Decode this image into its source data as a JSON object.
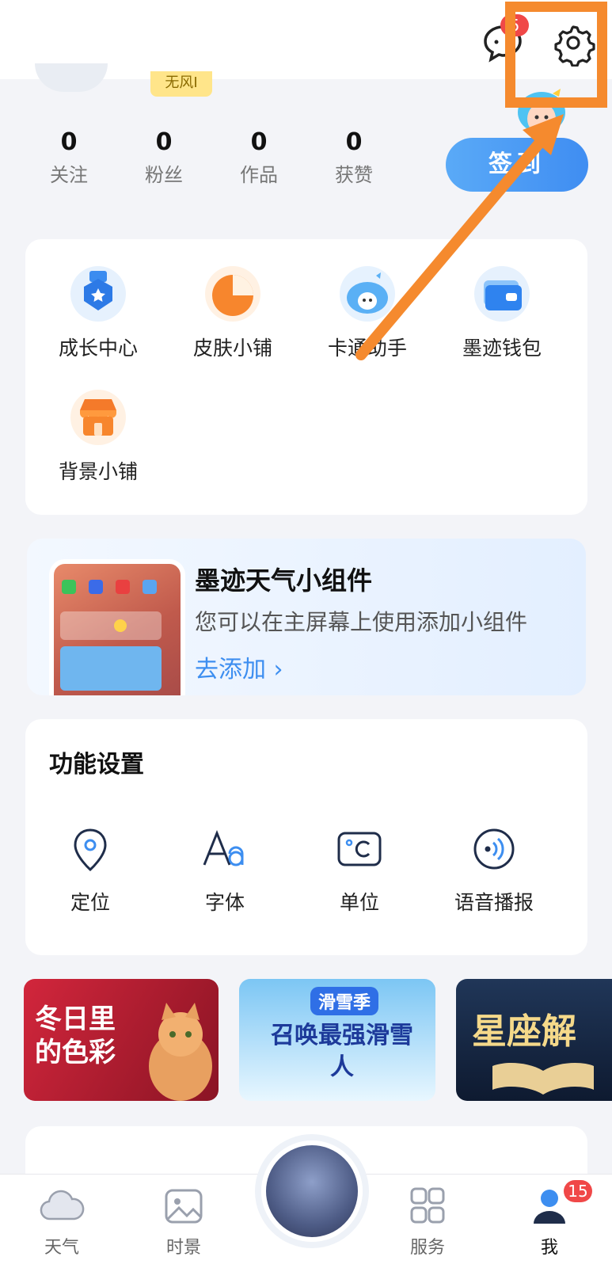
{
  "header": {
    "messages_badge": "5",
    "partial_badge_text": "无风I"
  },
  "stats": [
    {
      "value": "0",
      "label": "关注"
    },
    {
      "value": "0",
      "label": "粉丝"
    },
    {
      "value": "0",
      "label": "作品"
    },
    {
      "value": "0",
      "label": "获赞"
    }
  ],
  "signin_label": "签到",
  "quick_items": [
    {
      "label": "成长中心",
      "icon": "growth-medal-icon"
    },
    {
      "label": "皮肤小铺",
      "icon": "skin-shop-icon"
    },
    {
      "label": "卡通助手",
      "icon": "cartoon-assistant-icon"
    },
    {
      "label": "墨迹钱包",
      "icon": "wallet-icon"
    },
    {
      "label": "背景小铺",
      "icon": "background-shop-icon"
    }
  ],
  "widget": {
    "title": "墨迹天气小组件",
    "desc": "您可以在主屏幕上使用添加小组件",
    "add": "去添加 ›"
  },
  "functions": {
    "title": "功能设置",
    "items": [
      {
        "label": "定位",
        "icon": "location-pin-icon"
      },
      {
        "label": "字体",
        "icon": "font-icon"
      },
      {
        "label": "单位",
        "icon": "celsius-icon"
      },
      {
        "label": "语音播报",
        "icon": "voice-broadcast-icon"
      }
    ]
  },
  "banners": [
    {
      "text": "冬日里的色彩",
      "colors": [
        "#c8243a",
        "#7a1020"
      ]
    },
    {
      "text": "召唤最强滑雪人",
      "tag": "滑雪季",
      "colors": [
        "#6ab8f2",
        "#dff3ff"
      ]
    },
    {
      "text": "星座解",
      "colors": [
        "#1b2c4a",
        "#0d1729"
      ]
    }
  ],
  "tabs": [
    {
      "label": "天气",
      "icon": "cloud-icon"
    },
    {
      "label": "时景",
      "icon": "photo-icon"
    },
    {
      "label": "服务",
      "icon": "grid-icon"
    },
    {
      "label": "我",
      "icon": "person-icon"
    }
  ],
  "tab_badge": "15",
  "colors": {
    "accent": "#3d8ef0",
    "highlight": "#f58a2e",
    "badge": "#f04848"
  }
}
